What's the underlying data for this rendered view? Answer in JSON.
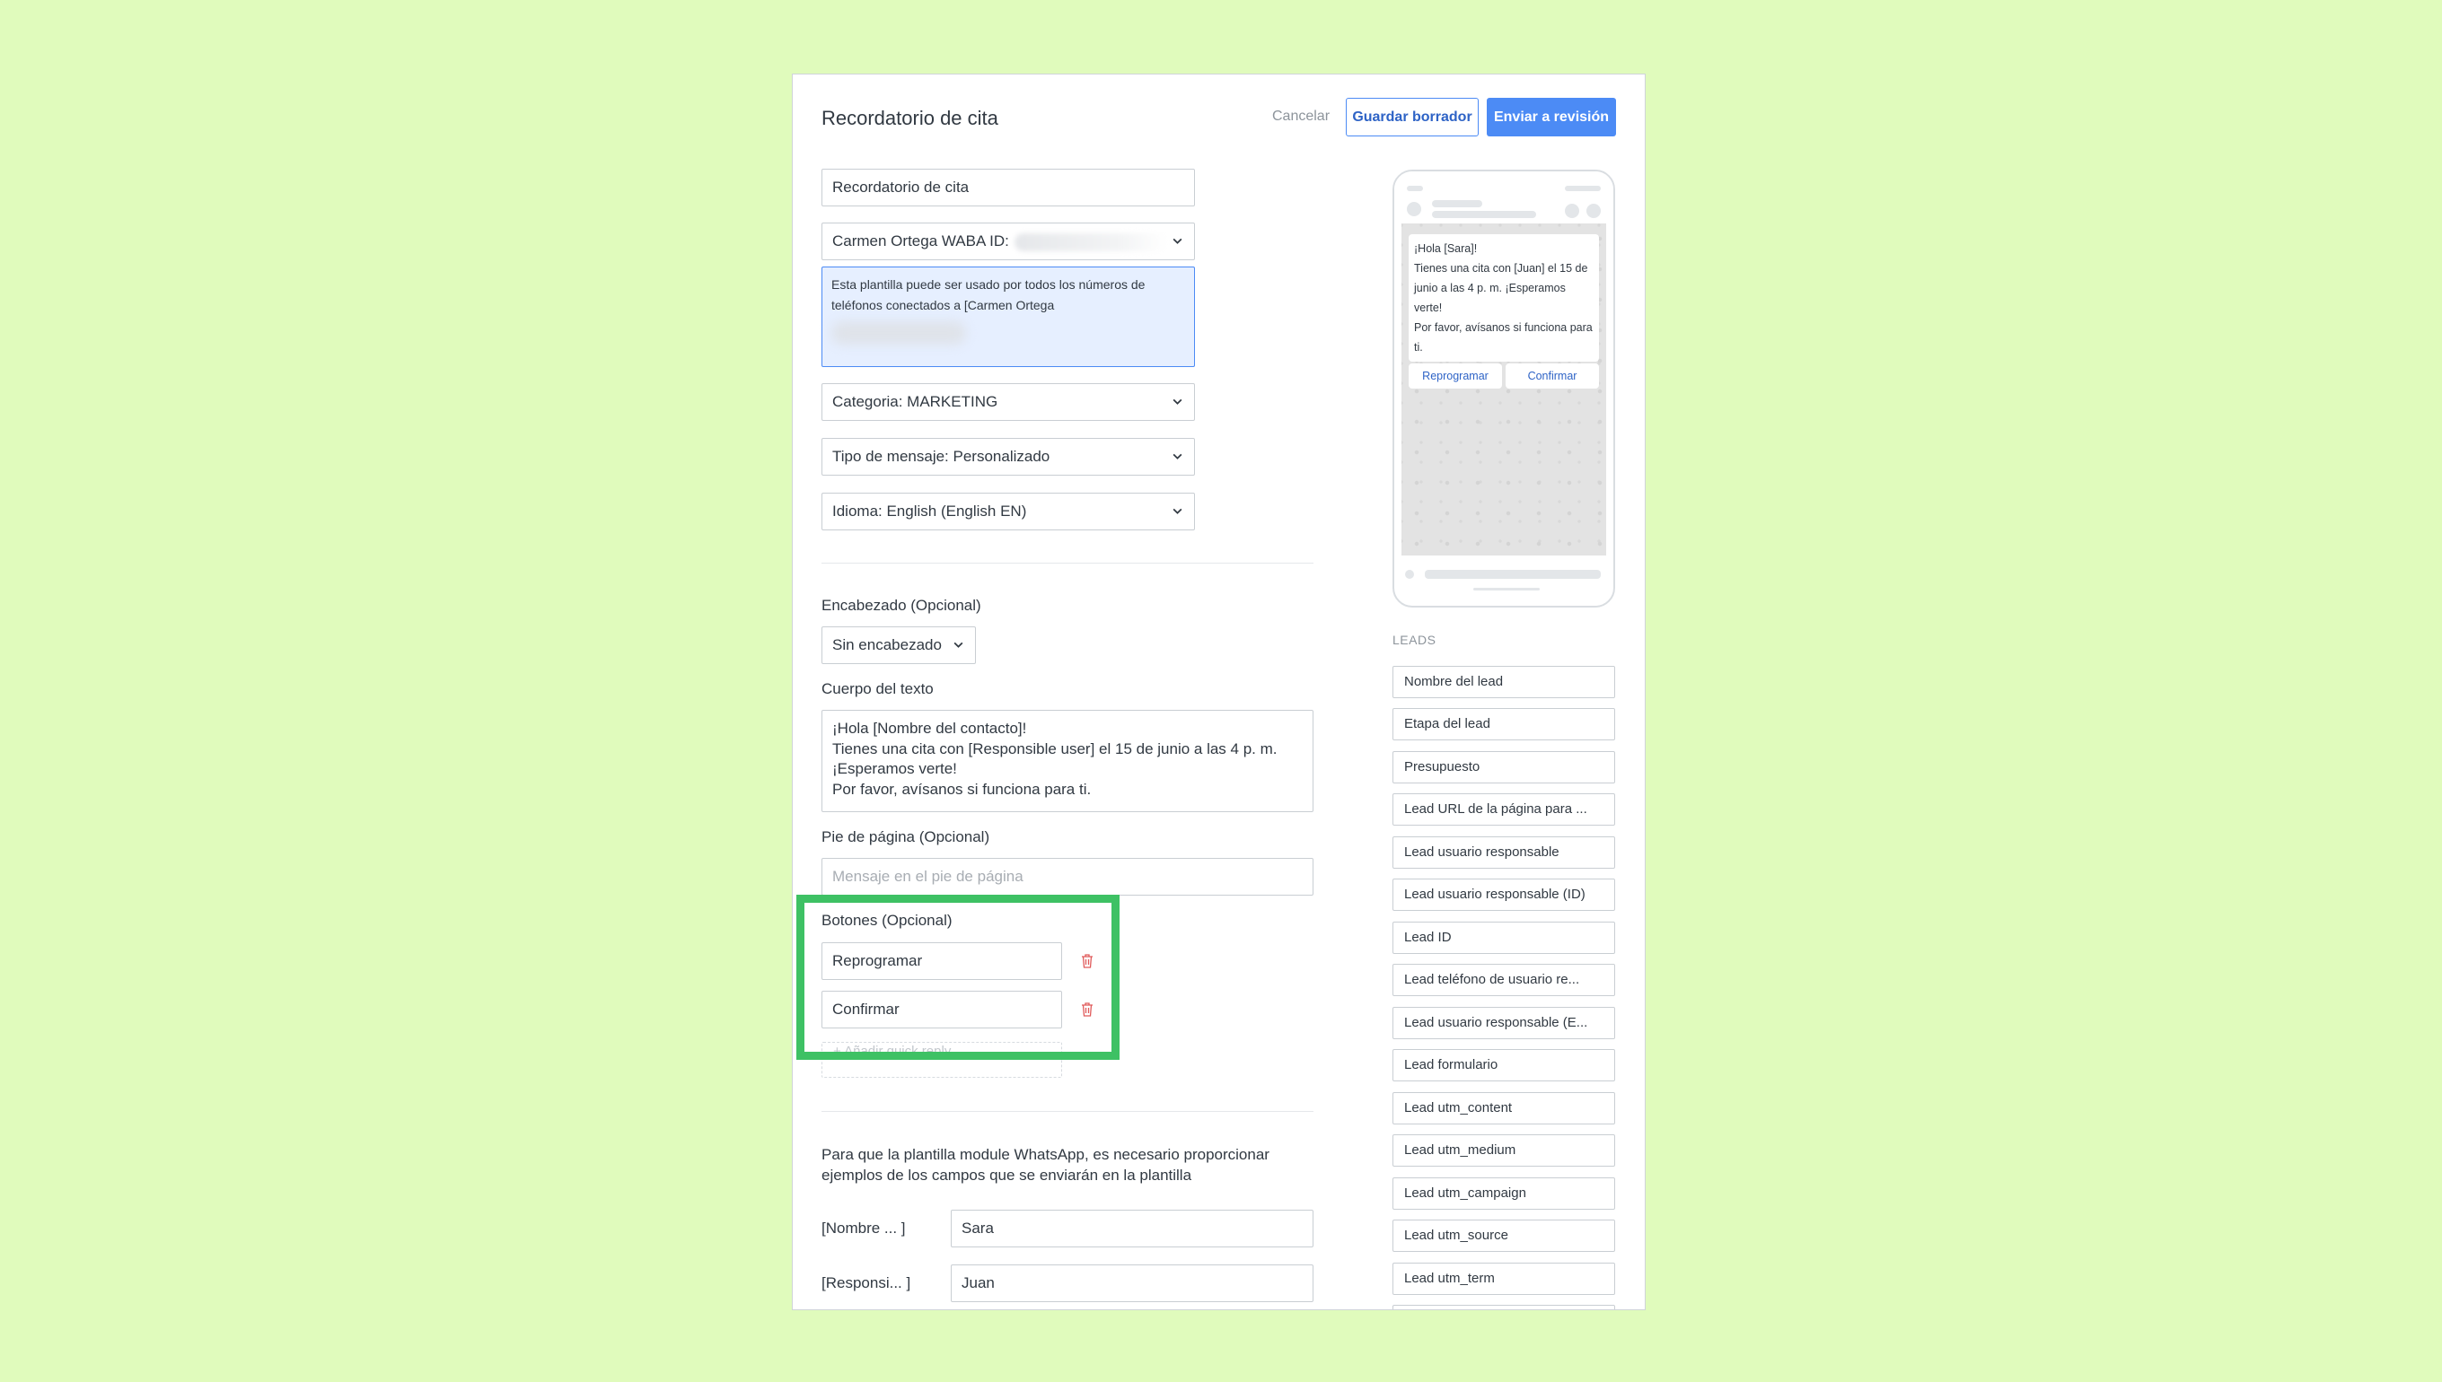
{
  "header": {
    "title": "Recordatorio de cita",
    "cancel": "Cancelar",
    "save_draft": "Guardar borrador",
    "submit": "Enviar a revisión"
  },
  "form": {
    "template_name": "Recordatorio de cita",
    "account": "Carmen Ortega WABA ID:",
    "account_info": "Esta plantilla puede ser usado por todos los números de teléfonos conectados a [Carmen Ortega",
    "category": "Categoria: MARKETING",
    "message_type": "Tipo de mensaje: Personalizado",
    "language": "Idioma: English (English EN)",
    "header_label": "Encabezado (Opcional)",
    "header_value": "Sin encabezado",
    "body_label": "Cuerpo del texto",
    "body_lines": [
      "¡Hola [Nombre del contacto]!",
      "Tienes una cita con [Responsible user] el 15 de junio a las 4 p. m.",
      "¡Esperamos verte!",
      "Por favor, avísanos si funciona para ti."
    ],
    "footer_label": "Pie de página (Opcional)",
    "footer_placeholder": "Mensaje en el pie de página",
    "buttons_label": "Botones (Opcional)",
    "buttons": [
      "Reprogramar",
      "Confirmar"
    ],
    "add_button": "+ Añadir quick reply",
    "helper_text": "Para que la plantilla module WhatsApp, es necesario proporcionar ejemplos de los campos que se enviarán en la plantilla",
    "variables": [
      {
        "label": "[Nombre ... ]",
        "value": "Sara"
      },
      {
        "label": "[Responsi... ]",
        "value": "Juan"
      }
    ]
  },
  "preview": {
    "message_lines": [
      "¡Hola [Sara]!",
      "Tienes una cita con [Juan] el 15 de",
      "junio a las 4 p. m. ¡Esperamos",
      "verte!",
      "Por favor, avísanos si funciona para",
      "ti."
    ],
    "buttons": [
      "Reprogramar",
      "Confirmar"
    ]
  },
  "leads": {
    "title": "LEADS",
    "items": [
      "Nombre del lead",
      "Etapa del lead",
      "Presupuesto",
      "Lead URL de la página para ...",
      "Lead usuario responsable",
      "Lead usuario responsable (ID)",
      "Lead ID",
      "Lead teléfono de usuario re...",
      "Lead usuario responsable (E...",
      "Lead formulario",
      "Lead utm_content",
      "Lead utm_medium",
      "Lead utm_campaign",
      "Lead utm_source",
      "Lead utm_term"
    ]
  },
  "colors": {
    "background": "#e0fbbc",
    "accent": "#4c8bf5",
    "highlight": "#3ec164",
    "delete": "#e05a5a"
  }
}
